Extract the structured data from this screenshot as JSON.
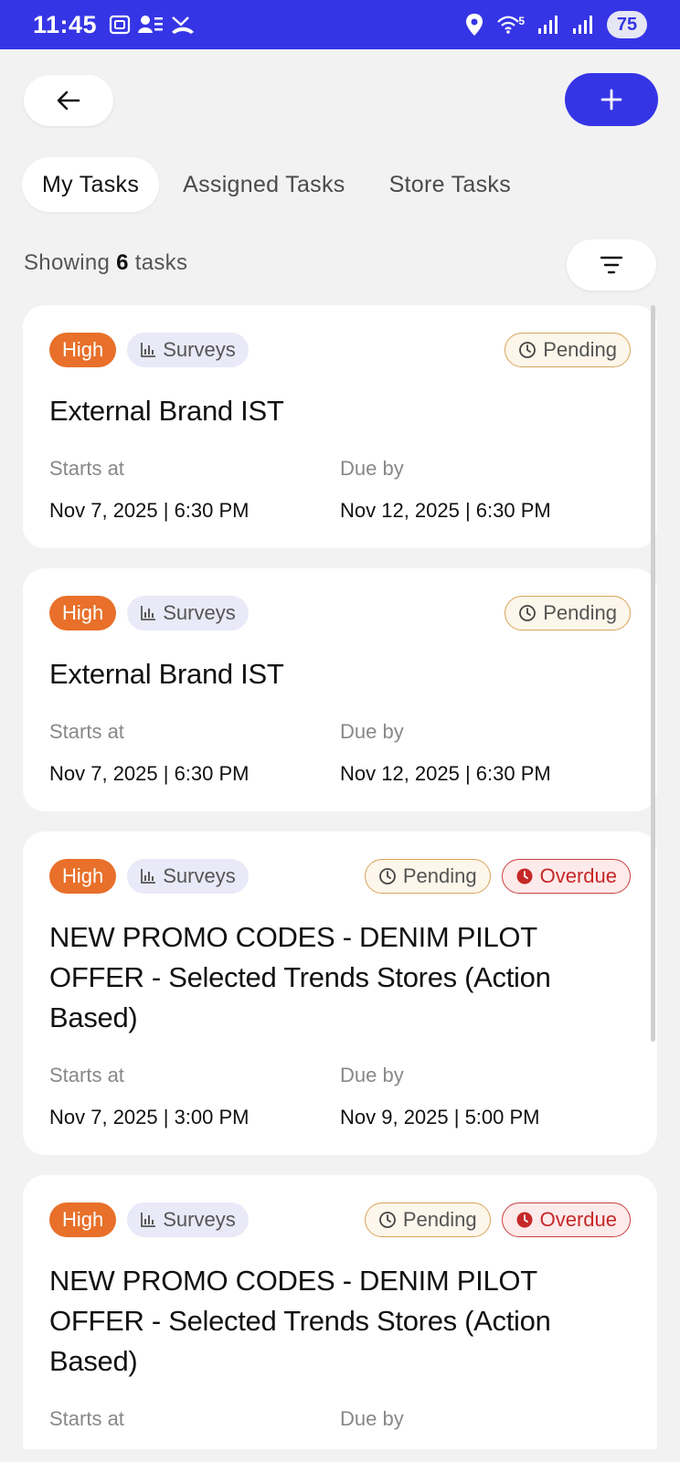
{
  "status_bar": {
    "time": "11:45",
    "battery": "75",
    "network": "5"
  },
  "tabs": [
    {
      "label": "My Tasks",
      "active": true
    },
    {
      "label": "Assigned Tasks",
      "active": false
    },
    {
      "label": "Store Tasks",
      "active": false
    }
  ],
  "summary": {
    "prefix": "Showing",
    "count": "6",
    "suffix": "tasks"
  },
  "colors": {
    "accent": "#3535e6",
    "high": "#e8702a",
    "overdue": "#c62828"
  },
  "tasks": [
    {
      "priority": "High",
      "category": "Surveys",
      "status": "Pending",
      "overdue": "",
      "title": "External Brand IST",
      "starts_label": "Starts at",
      "starts_value": "Nov 7, 2025 | 6:30 PM",
      "due_label": "Due by",
      "due_value": "Nov 12, 2025 | 6:30 PM"
    },
    {
      "priority": "High",
      "category": "Surveys",
      "status": "Pending",
      "overdue": "",
      "title": "External Brand IST",
      "starts_label": "Starts at",
      "starts_value": "Nov 7, 2025 | 6:30 PM",
      "due_label": "Due by",
      "due_value": "Nov 12, 2025 | 6:30 PM"
    },
    {
      "priority": "High",
      "category": "Surveys",
      "status": "Pending",
      "overdue": "Overdue",
      "title": "NEW PROMO CODES - DENIM PILOT OFFER - Selected Trends Stores (Action Based)",
      "starts_label": "Starts at",
      "starts_value": "Nov 7, 2025 | 3:00 PM",
      "due_label": "Due by",
      "due_value": "Nov 9, 2025 | 5:00 PM"
    },
    {
      "priority": "High",
      "category": "Surveys",
      "status": "Pending",
      "overdue": "Overdue",
      "title": "NEW PROMO CODES - DENIM PILOT OFFER - Selected Trends Stores (Action Based)",
      "starts_label": "Starts at",
      "due_label": "Due by"
    }
  ]
}
